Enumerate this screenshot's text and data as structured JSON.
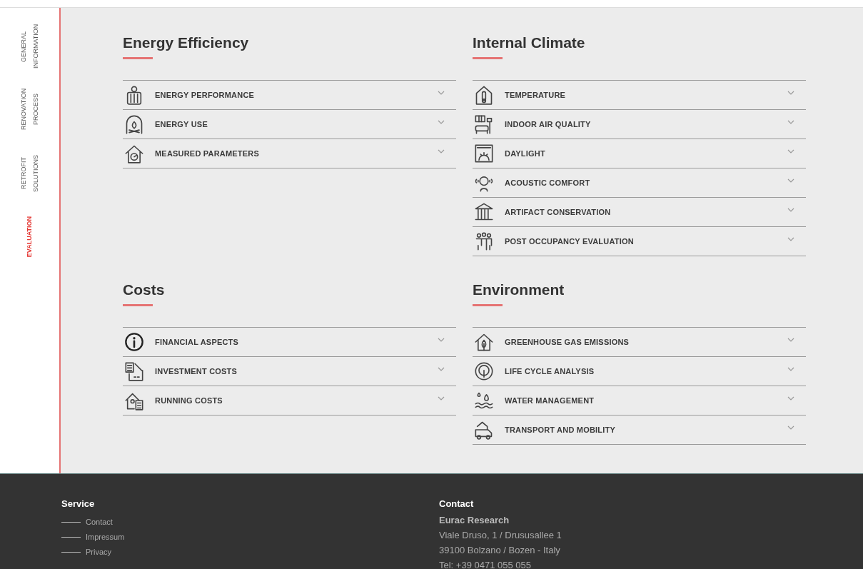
{
  "sidebar": {
    "items": [
      {
        "label": "GENERAL INFORMATION",
        "selected": false
      },
      {
        "label": "RENOVATION PROCESS",
        "selected": false
      },
      {
        "label": "RETROFIT SOLUTIONS",
        "selected": false
      },
      {
        "label": "EVALUATION",
        "selected": true
      }
    ]
  },
  "sections": [
    {
      "title": "Energy Efficiency",
      "items": [
        {
          "label": "ENERGY PERFORMANCE"
        },
        {
          "label": "ENERGY USE"
        },
        {
          "label": "MEASURED PARAMETERS"
        }
      ]
    },
    {
      "title": "Internal Climate",
      "items": [
        {
          "label": "TEMPERATURE"
        },
        {
          "label": "INDOOR AIR QUALITY"
        },
        {
          "label": "DAYLIGHT"
        },
        {
          "label": "ACOUSTIC COMFORT"
        },
        {
          "label": "ARTIFACT CONSERVATION"
        },
        {
          "label": "POST OCCUPANCY EVALUATION"
        }
      ]
    },
    {
      "title": "Costs",
      "items": [
        {
          "label": "FINANCIAL ASPECTS"
        },
        {
          "label": "INVESTMENT COSTS"
        },
        {
          "label": "RUNNING COSTS"
        }
      ]
    },
    {
      "title": "Environment",
      "items": [
        {
          "label": "GREENHOUSE GAS EMISSIONS"
        },
        {
          "label": "LIFE CYCLE ANALYSIS"
        },
        {
          "label": "WATER MANAGEMENT"
        },
        {
          "label": "TRANSPORT AND MOBILITY"
        }
      ]
    }
  ],
  "footer": {
    "service": {
      "title": "Service",
      "links": [
        "Contact",
        "Impressum",
        "Privacy"
      ]
    },
    "contact": {
      "title": "Contact",
      "organization": "Eurac Research",
      "lines": [
        "Viale Druso, 1 / Drususallee 1",
        "39100 Bolzano / Bozen - Italy",
        "Tel: +39 0471 055 055"
      ]
    }
  }
}
